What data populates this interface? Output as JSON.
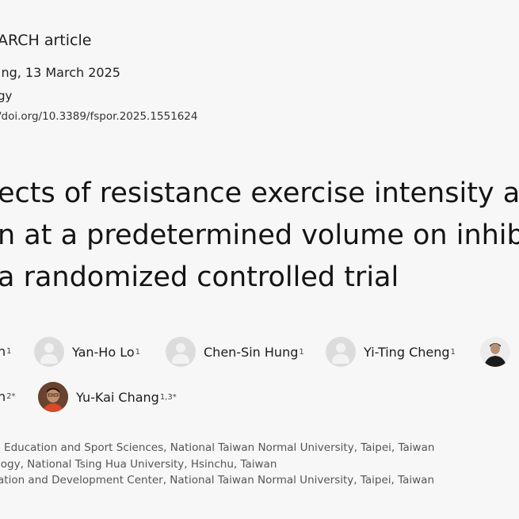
{
  "article_type": "ARCH article",
  "published": "ing, 13 March 2025",
  "section": "gy",
  "doi": "/doi.org/10.3389/fspor.2025.1551624",
  "title_lines": [
    "ects of resistance exercise intensity a",
    "n at a predetermined volume on inhib",
    "a randomized controlled trial"
  ],
  "authors": [
    {
      "name": "n",
      "sup": "1"
    },
    {
      "name": "Yan-Ho Lo",
      "sup": "1"
    },
    {
      "name": "Chen-Sin Hung",
      "sup": "1"
    },
    {
      "name": "Yi-Ting Cheng",
      "sup": "1"
    },
    {
      "name": "n",
      "sup": "2*"
    },
    {
      "name": "Yu-Kai Chang",
      "sup": "1,3*"
    }
  ],
  "affiliations": [
    "l Education and Sport Sciences, National Taiwan Normal University, Taipei, Taiwan",
    "logy, National Tsing Hua University, Hsinchu, Taiwan",
    "ation and Development Center, National Taiwan Normal University, Taipei, Taiwan"
  ]
}
